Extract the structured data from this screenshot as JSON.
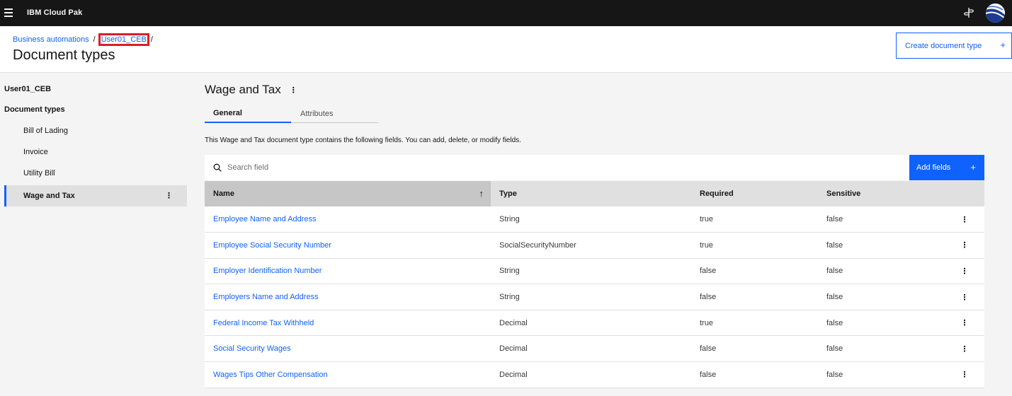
{
  "topbar": {
    "brand_bold": "IBM Cloud Pak",
    "icons": [
      "menu-icon",
      "signpost-icon",
      "avatar"
    ]
  },
  "header": {
    "breadcrumb": [
      {
        "label": "Business automations"
      },
      {
        "label": "User01_CEB"
      }
    ],
    "separator": "/",
    "title": "Document types",
    "create_label": "Create document type",
    "create_icon": "+"
  },
  "sidebar": {
    "root": "User01_CEB",
    "section": "Document types",
    "items": [
      {
        "label": "Bill of Lading"
      },
      {
        "label": "Invoice"
      },
      {
        "label": "Utility Bill"
      },
      {
        "label": "Wage and Tax"
      }
    ],
    "active_index": 3,
    "kebab": "⋮"
  },
  "main": {
    "heading": "Wage and Tax",
    "kebab": "⋮",
    "tabs": [
      {
        "label": "General"
      },
      {
        "label": "Attributes"
      }
    ],
    "active_tab": "General",
    "description": "This Wage and Tax document type contains the following fields. You can add, delete, or modify fields.",
    "search": {
      "placeholder": "Search field",
      "value": ""
    },
    "add_fields_label": "Add fields",
    "add_fields_icon": "+"
  },
  "table": {
    "columns": [
      "Name",
      "Type",
      "Required",
      "Sensitive"
    ],
    "sort_icon": "↑",
    "rows": [
      {
        "name": "Employee Name and Address",
        "type": "String",
        "required": "true",
        "sensitive": "false"
      },
      {
        "name": "Employee Social Security Number",
        "type": "SocialSecurityNumber",
        "required": "true",
        "sensitive": "false"
      },
      {
        "name": "Employer Identification Number",
        "type": "String",
        "required": "false",
        "sensitive": "false"
      },
      {
        "name": "Employers Name and Address",
        "type": "String",
        "required": "false",
        "sensitive": "false"
      },
      {
        "name": "Federal Income Tax Withheld",
        "type": "Decimal",
        "required": "true",
        "sensitive": "false"
      },
      {
        "name": "Social Security Wages",
        "type": "Decimal",
        "required": "false",
        "sensitive": "false"
      },
      {
        "name": "Wages Tips Other Compensation",
        "type": "Decimal",
        "required": "false",
        "sensitive": "false"
      }
    ],
    "row_kebab": "⋮"
  },
  "colors": {
    "accent": "#0f62fe",
    "highlight_box": "#da1e28",
    "topbar": "#161616"
  }
}
